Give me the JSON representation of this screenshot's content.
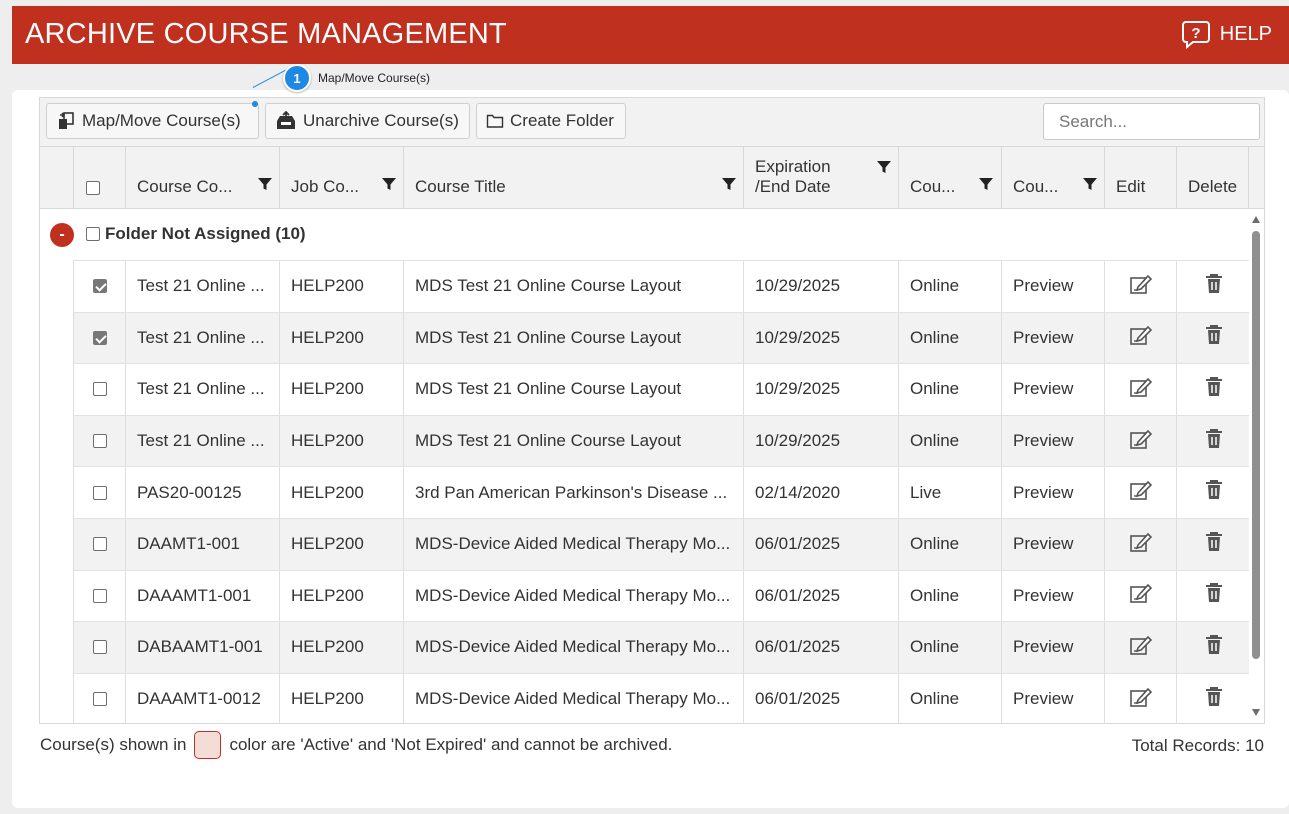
{
  "header": {
    "title": "ARCHIVE COURSE MANAGEMENT",
    "help_label": "HELP"
  },
  "callout": {
    "number": "1",
    "text": "Map/Move Course(s)"
  },
  "toolbar": {
    "map_move_label": "Map/Move Course(s)",
    "unarchive_label": "Unarchive Course(s)",
    "create_folder_label": "Create Folder",
    "search_placeholder": "Search..."
  },
  "columns": {
    "course_code": "Course Co...",
    "job_code": "Job Co...",
    "course_title": "Course Title",
    "expiration_line1": "Expiration",
    "expiration_line2": "/End Date",
    "course_type": "Cou...",
    "course_preview": "Cou...",
    "edit": "Edit",
    "delete": "Delete"
  },
  "group": {
    "title": "Folder Not Assigned (10)",
    "toggle": "-"
  },
  "rows": [
    {
      "checked": true,
      "code": "Test 21 Online ...",
      "job": "HELP200",
      "title": "MDS Test 21 Online Course Layout",
      "date": "10/29/2025",
      "type": "Online",
      "preview": "Preview"
    },
    {
      "checked": true,
      "code": "Test 21 Online ...",
      "job": "HELP200",
      "title": "MDS Test 21 Online Course Layout",
      "date": "10/29/2025",
      "type": "Online",
      "preview": "Preview"
    },
    {
      "checked": false,
      "code": "Test 21 Online ...",
      "job": "HELP200",
      "title": "MDS Test 21 Online Course Layout",
      "date": "10/29/2025",
      "type": "Online",
      "preview": "Preview"
    },
    {
      "checked": false,
      "code": "Test 21 Online ...",
      "job": "HELP200",
      "title": "MDS Test 21 Online Course Layout",
      "date": "10/29/2025",
      "type": "Online",
      "preview": "Preview"
    },
    {
      "checked": false,
      "code": "PAS20-00125",
      "job": "HELP200",
      "title": "3rd Pan American Parkinson's Disease ...",
      "date": "02/14/2020",
      "type": "Live",
      "preview": "Preview"
    },
    {
      "checked": false,
      "code": "DAAMT1-001",
      "job": "HELP200",
      "title": "MDS-Device Aided Medical Therapy Mo...",
      "date": "06/01/2025",
      "type": "Online",
      "preview": "Preview"
    },
    {
      "checked": false,
      "code": "DAAAMT1-001",
      "job": "HELP200",
      "title": "MDS-Device Aided Medical Therapy Mo...",
      "date": "06/01/2025",
      "type": "Online",
      "preview": "Preview"
    },
    {
      "checked": false,
      "code": "DABAAMT1-001",
      "job": "HELP200",
      "title": "MDS-Device Aided Medical Therapy Mo...",
      "date": "06/01/2025",
      "type": "Online",
      "preview": "Preview"
    },
    {
      "checked": false,
      "code": "DAAAMT1-0012",
      "job": "HELP200",
      "title": "MDS-Device Aided Medical Therapy Mo...",
      "date": "06/01/2025",
      "type": "Online",
      "preview": "Preview"
    }
  ],
  "footer": {
    "note_before": "Course(s) shown in",
    "note_after": "color are 'Active' and 'Not Expired' and cannot be archived.",
    "total_records": "Total Records: 10"
  },
  "colors": {
    "header_bg": "#c0301f",
    "callout_blue": "#1e88e5",
    "active_swatch": "#f4dcd7"
  }
}
